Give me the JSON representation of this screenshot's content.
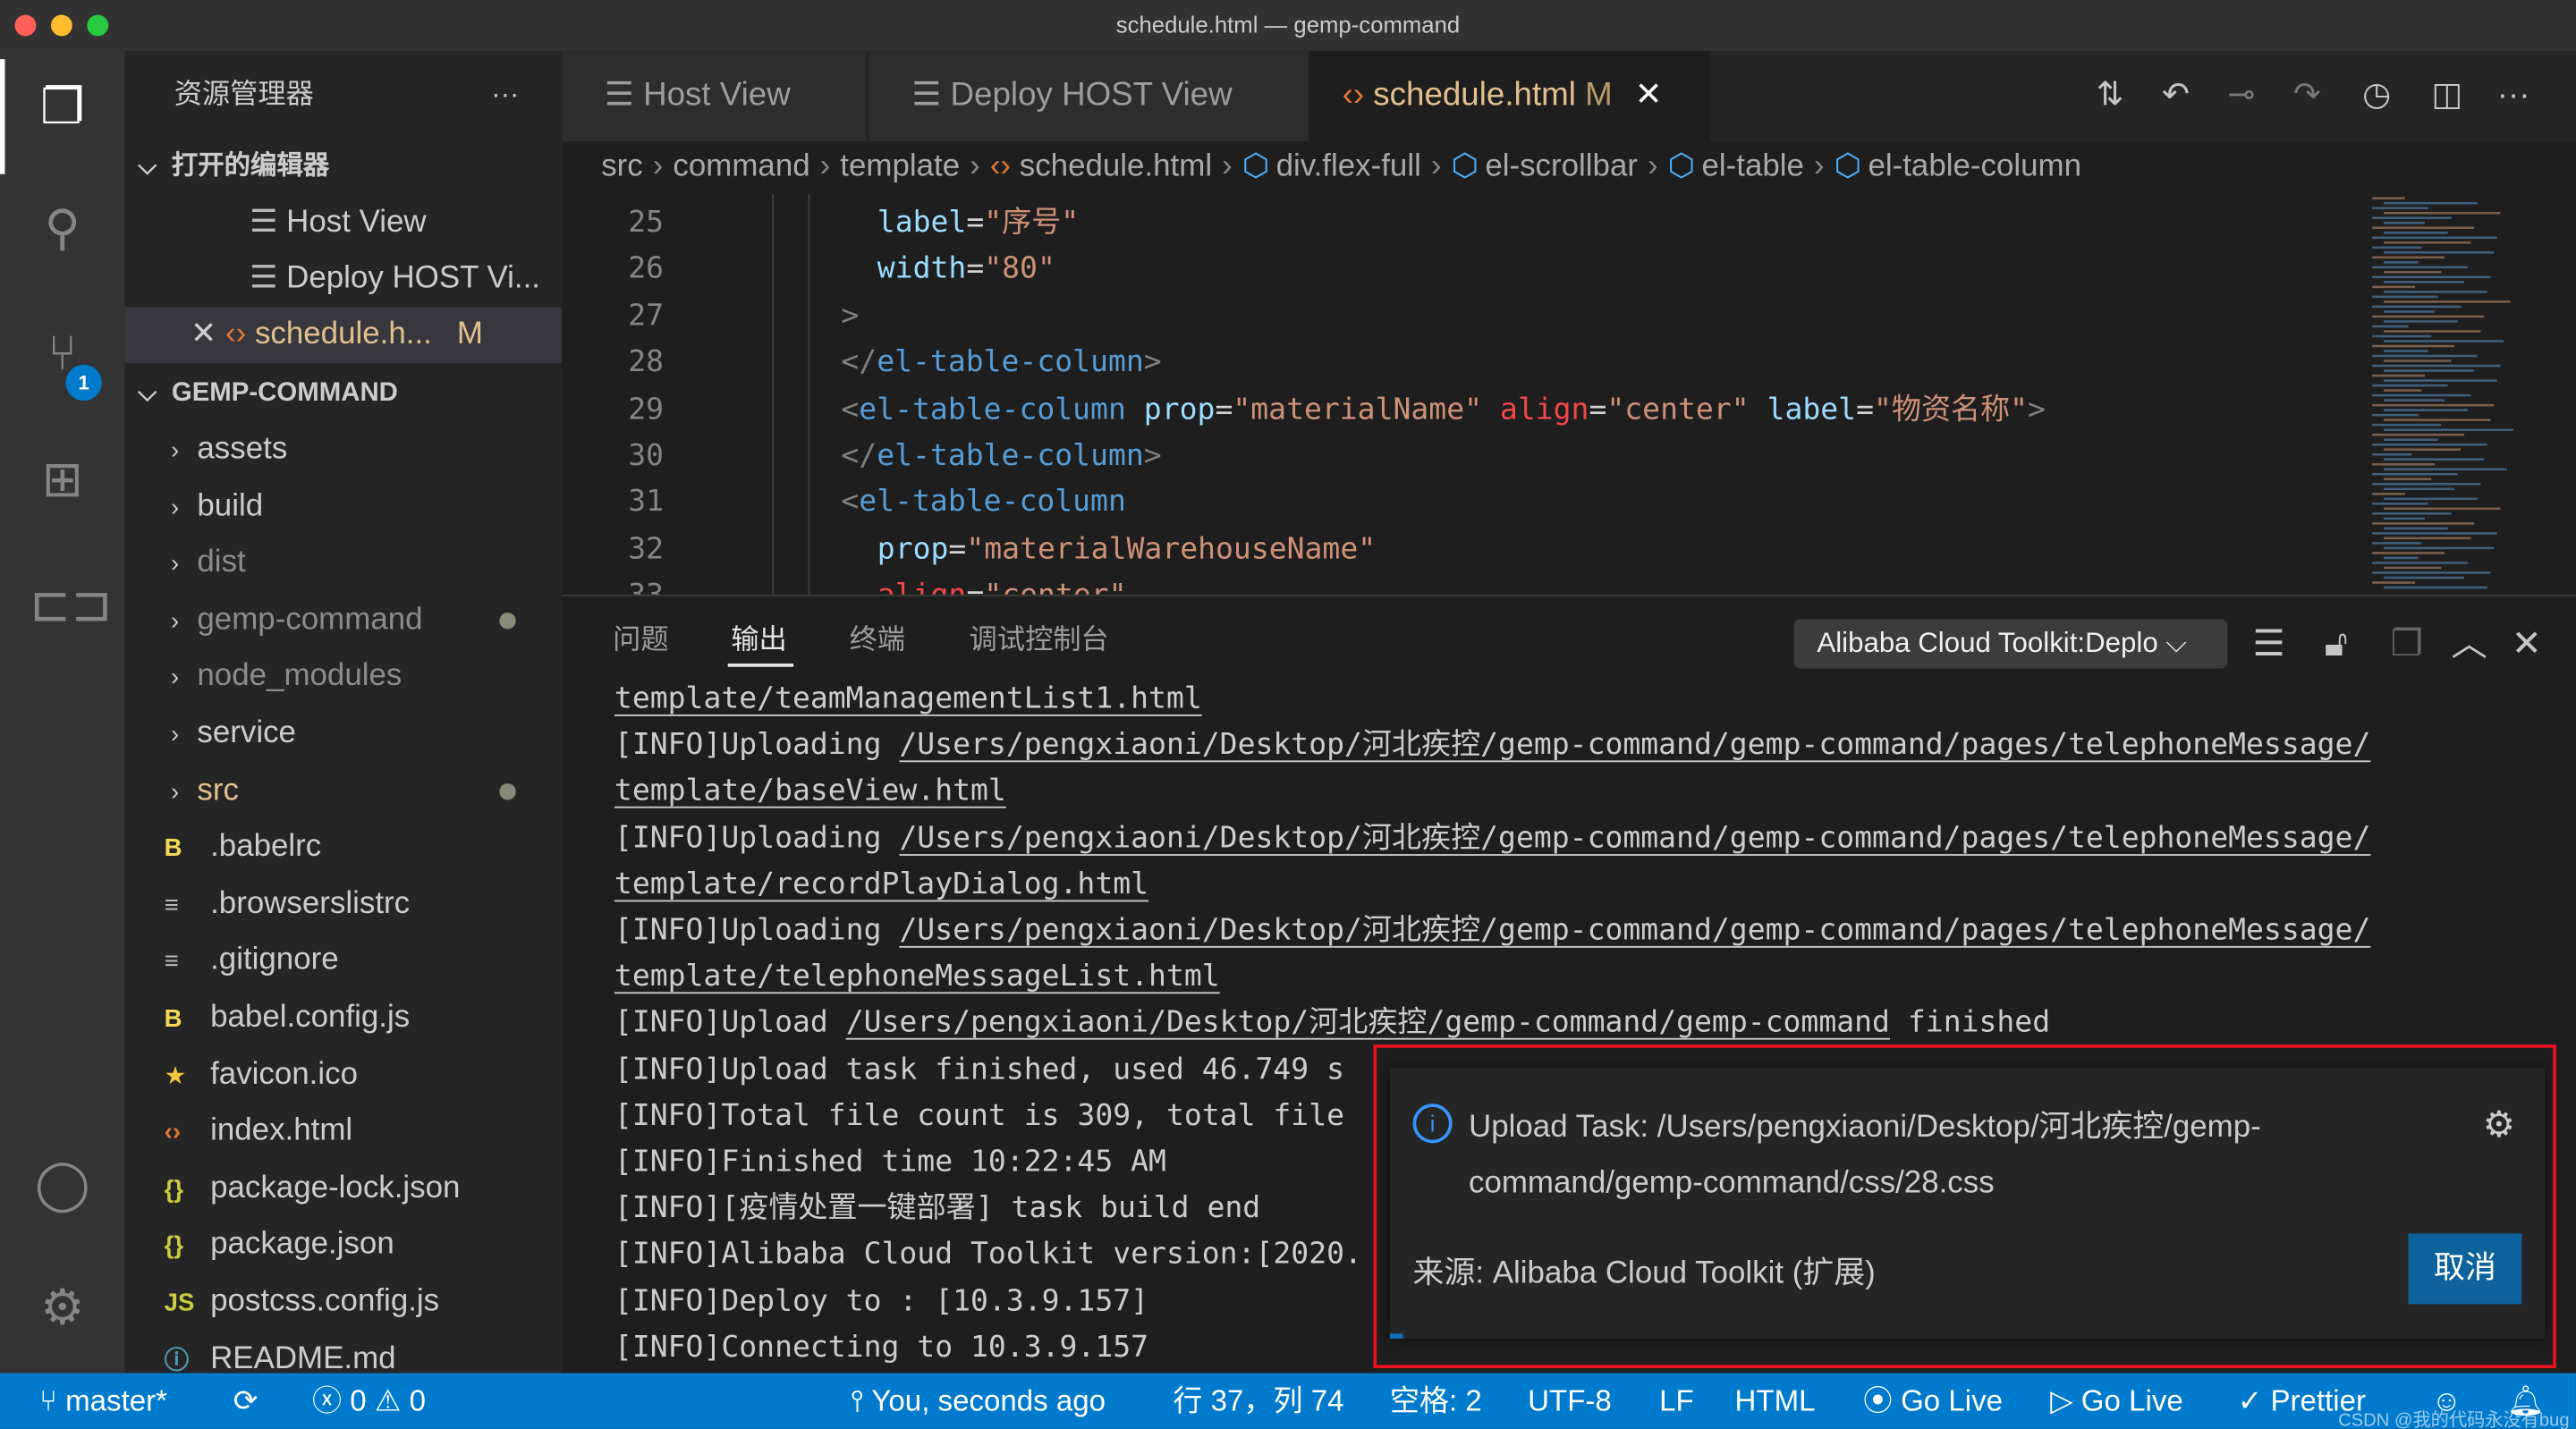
{
  "window": {
    "title": "schedule.html — gemp-command"
  },
  "colors": {
    "accent": "#007acc",
    "activity_bar": "#333333",
    "sidebar": "#252526",
    "editor": "#1e1e1e",
    "highlight_box": "#e81123",
    "modified": "#e2c08d"
  },
  "activity_bar": {
    "items": [
      {
        "icon": "files-icon"
      },
      {
        "icon": "search-icon"
      },
      {
        "icon": "source-control-icon",
        "badge": "1"
      },
      {
        "icon": "extensions-icon"
      },
      {
        "icon": "remote-icon"
      },
      {
        "icon": "account-icon"
      },
      {
        "icon": "gear-icon"
      }
    ]
  },
  "sidebar": {
    "title": "资源管理器",
    "more": "···",
    "open_editors": {
      "title": "打开的编辑器",
      "items": [
        {
          "label": "Host View"
        },
        {
          "label": "Deploy HOST Vi..."
        },
        {
          "label": "schedule.h...",
          "badge": "M"
        }
      ]
    },
    "project": {
      "title": "GEMP-COMMAND",
      "items": [
        {
          "label": "assets",
          "type": "folder"
        },
        {
          "label": "build",
          "type": "folder"
        },
        {
          "label": "dist",
          "type": "folder",
          "dim": true
        },
        {
          "label": "gemp-command",
          "type": "folder",
          "dim": true,
          "dot": true
        },
        {
          "label": "node_modules",
          "type": "folder",
          "dim": true
        },
        {
          "label": "service",
          "type": "folder"
        },
        {
          "label": "src",
          "type": "folder",
          "modified": true,
          "dot": true
        },
        {
          "label": ".babelrc",
          "icon": "babel"
        },
        {
          "label": ".browserslistrc",
          "icon": "lines"
        },
        {
          "label": ".gitignore",
          "icon": "lines"
        },
        {
          "label": "babel.config.js",
          "icon": "babel"
        },
        {
          "label": "favicon.ico",
          "icon": "star"
        },
        {
          "label": "index.html",
          "icon": "html"
        },
        {
          "label": "package-lock.json",
          "icon": "json"
        },
        {
          "label": "package.json",
          "icon": "json"
        },
        {
          "label": "postcss.config.js",
          "icon": "js"
        },
        {
          "label": "README.md",
          "icon": "info"
        }
      ]
    }
  },
  "tabs": [
    {
      "label": "Host View"
    },
    {
      "label": "Deploy HOST View"
    },
    {
      "label": "schedule.html",
      "badge": "M",
      "active": true
    }
  ],
  "breadcrumb": [
    "src",
    "command",
    "template",
    "schedule.html",
    "div.flex-full",
    "el-scrollbar",
    "el-table",
    "el-table-column"
  ],
  "code": [
    {
      "n": "25",
      "indent": 1,
      "tokens": [
        [
          "attr",
          "label"
        ],
        [
          "eq",
          "="
        ],
        [
          "str",
          "\"序号\""
        ]
      ]
    },
    {
      "n": "26",
      "indent": 1,
      "tokens": [
        [
          "attr",
          "width"
        ],
        [
          "eq",
          "="
        ],
        [
          "str",
          "\"80\""
        ]
      ]
    },
    {
      "n": "27",
      "indent": 0,
      "tokens": [
        [
          "p",
          ">"
        ]
      ]
    },
    {
      "n": "28",
      "indent": 0,
      "tokens": [
        [
          "p",
          "</"
        ],
        [
          "tag",
          "el-table-column"
        ],
        [
          "p",
          ">"
        ]
      ]
    },
    {
      "n": "29",
      "indent": 0,
      "tokens": [
        [
          "p",
          "<"
        ],
        [
          "tag",
          "el-table-column"
        ],
        [
          "eq",
          " "
        ],
        [
          "attr",
          "prop"
        ],
        [
          "eq",
          "="
        ],
        [
          "str",
          "\"materialName\""
        ],
        [
          "eq",
          " "
        ],
        [
          "err",
          "align"
        ],
        [
          "eq",
          "="
        ],
        [
          "str",
          "\"center\""
        ],
        [
          "eq",
          " "
        ],
        [
          "attr",
          "label"
        ],
        [
          "eq",
          "="
        ],
        [
          "str",
          "\"物资名称\""
        ],
        [
          "p",
          ">"
        ]
      ]
    },
    {
      "n": "30",
      "indent": 0,
      "tokens": [
        [
          "p",
          "</"
        ],
        [
          "tag",
          "el-table-column"
        ],
        [
          "p",
          ">"
        ]
      ]
    },
    {
      "n": "31",
      "indent": 0,
      "tokens": [
        [
          "p",
          "<"
        ],
        [
          "tag",
          "el-table-column"
        ]
      ]
    },
    {
      "n": "32",
      "indent": 1,
      "tokens": [
        [
          "attr",
          "prop"
        ],
        [
          "eq",
          "="
        ],
        [
          "str",
          "\"materialWarehouseName\""
        ]
      ]
    },
    {
      "n": "33",
      "indent": 1,
      "tokens": [
        [
          "err",
          "align"
        ],
        [
          "eq",
          "="
        ],
        [
          "str",
          "\"center\""
        ]
      ]
    }
  ],
  "panel": {
    "tabs": [
      {
        "label": "问题"
      },
      {
        "label": "输出",
        "active": true
      },
      {
        "label": "终端"
      },
      {
        "label": "调试控制台"
      }
    ],
    "channel": "Alibaba Cloud Toolkit:Deplo",
    "output": [
      [
        [
          "l",
          "template/teamManagementList1.html"
        ]
      ],
      [
        [
          "t",
          "[INFO]Uploading "
        ],
        [
          "l",
          "/Users/pengxiaoni/Desktop/河北疾控/gemp-command/gemp-command/pages/telephoneMessage/"
        ]
      ],
      [
        [
          "l",
          "template/baseView.html"
        ]
      ],
      [
        [
          "t",
          "[INFO]Uploading "
        ],
        [
          "l",
          "/Users/pengxiaoni/Desktop/河北疾控/gemp-command/gemp-command/pages/telephoneMessage/"
        ]
      ],
      [
        [
          "l",
          "template/recordPlayDialog.html"
        ]
      ],
      [
        [
          "t",
          "[INFO]Uploading "
        ],
        [
          "l",
          "/Users/pengxiaoni/Desktop/河北疾控/gemp-command/gemp-command/pages/telephoneMessage/"
        ]
      ],
      [
        [
          "l",
          "template/telephoneMessageList.html"
        ]
      ],
      [
        [
          "t",
          "[INFO]Upload "
        ],
        [
          "l",
          "/Users/pengxiaoni/Desktop/河北疾控/gemp-command/gemp-command"
        ],
        [
          "t",
          " finished"
        ]
      ],
      [
        [
          "t",
          "[INFO]Upload task finished, used 46.749 s"
        ]
      ],
      [
        [
          "t",
          "[INFO]Total file count is 309, total file"
        ]
      ],
      [
        [
          "t",
          "[INFO]Finished time 10:22:45 AM"
        ]
      ],
      [
        [
          "t",
          "[INFO][疫情处置一键部署] task build end"
        ]
      ],
      [
        [
          "t",
          "[INFO]Alibaba Cloud Toolkit version:[2020."
        ]
      ],
      [
        [
          "t",
          "[INFO]Deploy to : [10.3.9.157]"
        ]
      ],
      [
        [
          "t",
          "[INFO]Connecting to 10.3.9.157"
        ]
      ]
    ]
  },
  "notification": {
    "line1": "Upload Task: /Users/pengxiaoni/Desktop/河北疾控/gemp-",
    "line2": "command/gemp-command/css/28.css",
    "source": "来源: Alibaba Cloud Toolkit (扩展)",
    "cancel": "取消",
    "progress": 0.01
  },
  "status": {
    "branch": "master*",
    "errors": "0",
    "warnings": "0",
    "blame": "You, seconds ago",
    "position": "行 37，列 74",
    "spaces": "空格: 2",
    "encoding": "UTF-8",
    "eol": "LF",
    "language": "HTML",
    "golive1": "Go Live",
    "golive2": "Go Live",
    "prettier": "Prettier",
    "watermark": "CSDN @我的代码永没有bug"
  }
}
